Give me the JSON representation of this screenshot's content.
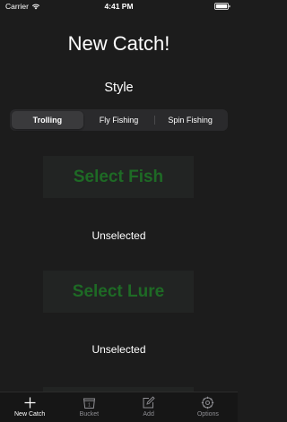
{
  "status_bar": {
    "carrier": "Carrier",
    "time": "4:41 PM"
  },
  "title": "New Catch!",
  "style_label": "Style",
  "style_options": [
    "Trolling",
    "Fly Fishing",
    "Spin Fishing"
  ],
  "selected_style": "Trolling",
  "fish": {
    "button_label": "Select Fish",
    "value": "Unselected"
  },
  "lure": {
    "button_label": "Select Lure",
    "value": "Unselected"
  },
  "tabs": [
    {
      "label": "New Catch",
      "icon": "plus-icon",
      "active": true
    },
    {
      "label": "Bucket",
      "icon": "bucket-icon",
      "active": false
    },
    {
      "label": "Add",
      "icon": "compose-icon",
      "active": false
    },
    {
      "label": "Options",
      "icon": "gear-icon",
      "active": false
    }
  ],
  "colors": {
    "background": "#1c1c1c",
    "select_button_text": "#1e6a25",
    "tab_inactive": "#8e8e93"
  }
}
